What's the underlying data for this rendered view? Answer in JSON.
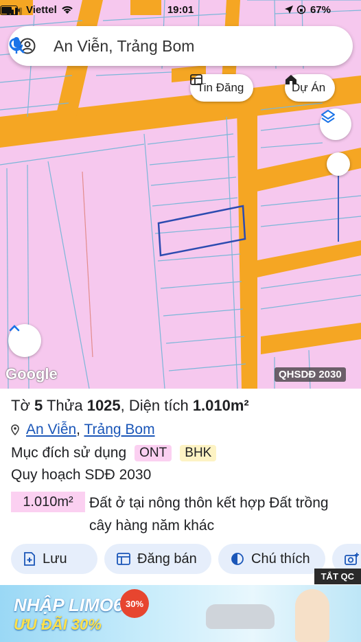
{
  "status_bar": {
    "carrier": "Viettel",
    "time": "19:01",
    "battery": "67%"
  },
  "search": {
    "query": "An Viễn, Trảng Bom"
  },
  "map_chips": {
    "listings": "Tin Đăng",
    "projects": "Dự Án"
  },
  "map": {
    "google_logo": "Google",
    "plan_badge": "QHSDĐ 2030"
  },
  "parcel": {
    "title_prefix": "Tờ ",
    "sheet": "5",
    "plot_label": " Thửa ",
    "plot": "1025",
    "area_label": ", Diện tích ",
    "area": "1.010m²",
    "commune": "An Viễn",
    "sep": ",",
    "district": "Trảng Bom",
    "purpose_label": "Mục đích sử dụng",
    "tags": [
      "ONT",
      "BHK"
    ],
    "plan_label": "Quy hoạch SDĐ 2030",
    "area_box": "1.010m²",
    "description": "Đất ở tại nông thôn kết hợp Đất trồng cây hàng năm khác"
  },
  "actions": {
    "save": "Lưu",
    "sell": "Đăng bán",
    "legend": "Chú thích"
  },
  "ad": {
    "close": "TẮT QC",
    "headline": "NHẬP LIMO6",
    "offer": "ƯU ĐÃI 30%",
    "badge": "30%"
  },
  "colors": {
    "map_pink": "#f6c8ee",
    "road_orange": "#f5a623",
    "parcel_blue": "#2c4bb0",
    "link_blue": "#1a56b8",
    "button_bg": "#e6eefb"
  }
}
